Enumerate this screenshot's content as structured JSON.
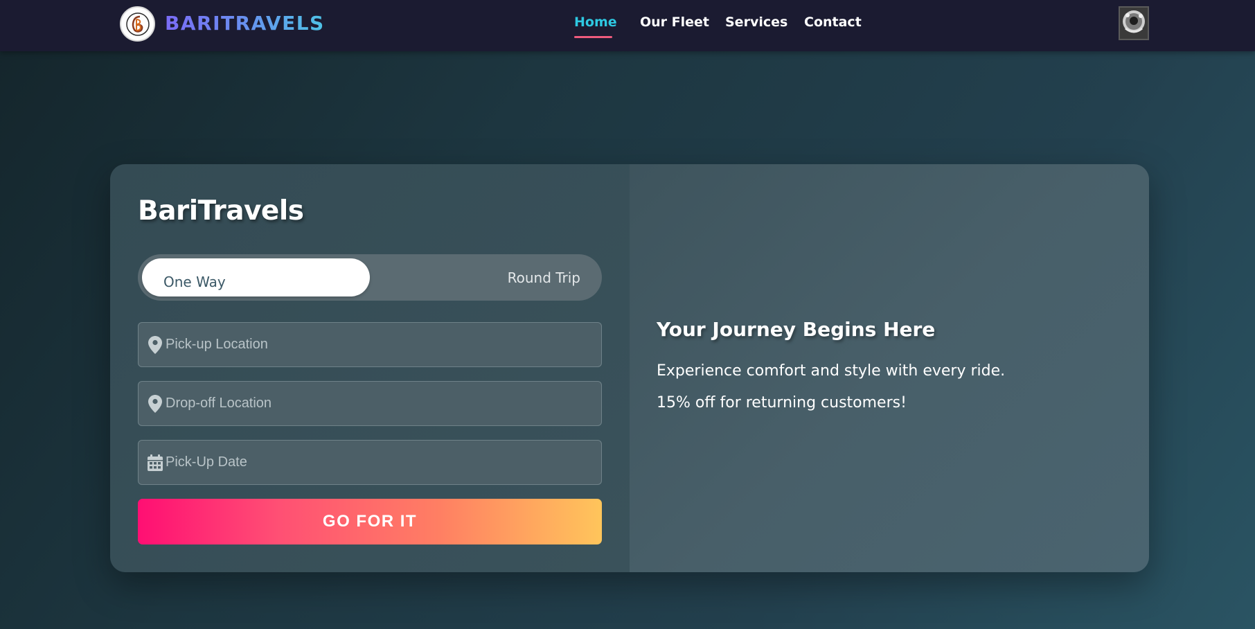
{
  "header": {
    "brand": "BARITRAVELS",
    "nav": [
      {
        "label": "Home",
        "active": true
      },
      {
        "label": "Our Fleet",
        "active": false
      },
      {
        "label": "Services",
        "active": false
      },
      {
        "label": "Contact",
        "active": false
      }
    ],
    "logo_icon": "bari-logo-icon",
    "avatar_icon": "user-avatar-icon"
  },
  "booking": {
    "title": "BariTravels",
    "trip_type": {
      "options": [
        "One Way",
        "Round Trip"
      ],
      "selected": "One Way"
    },
    "fields": {
      "pickup": {
        "placeholder": "Pick-up Location",
        "value": "",
        "icon": "map-pin-icon"
      },
      "dropoff": {
        "placeholder": "Drop-off Location",
        "value": "",
        "icon": "map-pin-icon"
      },
      "date": {
        "placeholder": "Pick-Up Date",
        "value": "",
        "icon": "calendar-icon"
      }
    },
    "submit_label": "GO FOR IT"
  },
  "hero": {
    "title": "Your Journey Begins Here",
    "line1": "Experience comfort and style with every ride.",
    "line2": "15% off for returning customers!"
  },
  "colors": {
    "nav_bg": "#1b1b31",
    "accent_active": "#2ec9e2",
    "underline": "#ee5b7d",
    "button_gradient": [
      "#ff0f73",
      "#ffc55b"
    ]
  }
}
